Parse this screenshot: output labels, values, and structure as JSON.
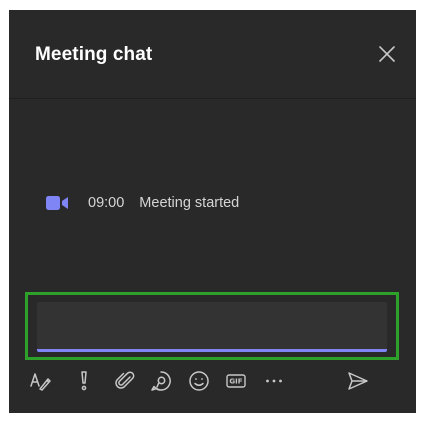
{
  "header": {
    "title": "Meeting chat",
    "close_icon": "close-icon"
  },
  "messages": [
    {
      "icon": "video-camera-icon",
      "time": "09:00",
      "text": "Meeting started"
    }
  ],
  "compose": {
    "placeholder": "",
    "value": ""
  },
  "toolbar": {
    "items": [
      {
        "icon": "format-icon",
        "label": "Format"
      },
      {
        "icon": "important-icon",
        "label": "Set delivery options"
      },
      {
        "icon": "attach-icon",
        "label": "Attach"
      },
      {
        "icon": "loop-icon",
        "label": "Loop components"
      },
      {
        "icon": "emoji-icon",
        "label": "Emoji"
      },
      {
        "icon": "gif-icon",
        "label": "GIF",
        "glyph": "GIF"
      },
      {
        "icon": "more-options-icon",
        "label": "More options"
      },
      {
        "icon": "send-icon",
        "label": "Send"
      }
    ]
  },
  "colors": {
    "panel_bg": "#292929",
    "accent": "#7f85f5",
    "highlight_frame": "#2da12a",
    "text": "#ffffff",
    "icon": "#c8c8c8"
  }
}
